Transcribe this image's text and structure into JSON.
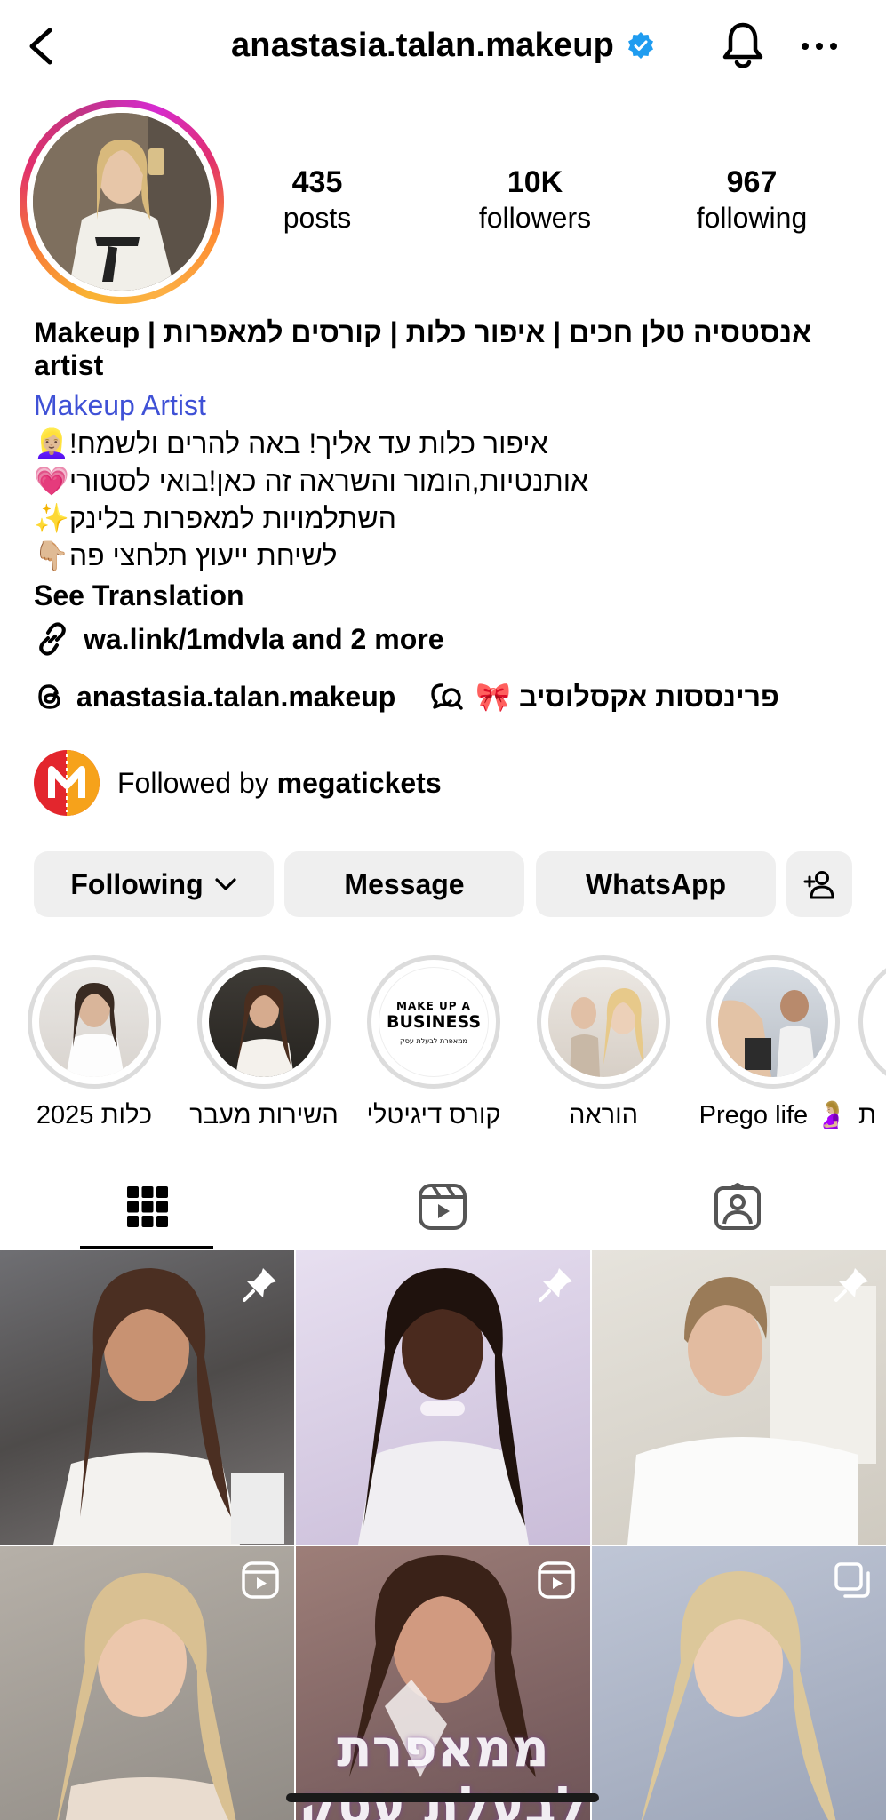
{
  "header": {
    "username": "anastasia.talan.makeup",
    "verified_icon": "verified-badge-icon",
    "accent": "#1f9cf0"
  },
  "stats": {
    "posts": {
      "value": "435",
      "label": "posts"
    },
    "followers": {
      "value": "10K",
      "label": "followers"
    },
    "following": {
      "value": "967",
      "label": "following"
    }
  },
  "bio": {
    "name_line1": "אנסטסיה טלן חכים | איפור כלות | קורסים למאפרות | Makeup",
    "name_line2": "artist",
    "category": "Makeup Artist",
    "lines": [
      "איפור כלות עד אליך! באה להרים ולשמח!👱🏼‍♀️",
      "אותנטיות,הומור והשראה זה כאן!בואי לסטורי💗",
      "השתלמויות למאפרות בלינק✨",
      "לשיחת ייעוץ תלחצי פה👇🏼"
    ],
    "see_translation": "See Translation",
    "link": "wa.link/1mdvla and 2 more",
    "threads_handle": "anastasia.talan.makeup",
    "community": "פרינססות אקסלוסיב 🎀"
  },
  "followed_by": {
    "prefix": "Followed by",
    "user": "megatickets"
  },
  "buttons": {
    "following": "Following",
    "message": "Message",
    "whatsapp": "WhatsApp"
  },
  "highlights": [
    {
      "label": "כלות 2025"
    },
    {
      "label": "השירות מעבר"
    },
    {
      "label": "קורס דיגיטלי"
    },
    {
      "label": "הוראה"
    },
    {
      "label": "Prego life 🤰🏼"
    },
    {
      "label": "ת"
    }
  ],
  "highlight_business": {
    "line1": "MAKE UP A",
    "line2": "BUSINESS",
    "line3": "ממאפרת לבעלת עסק"
  },
  "tabs": [
    "grid-icon",
    "reels-icon",
    "tagged-icon"
  ],
  "grid_overlay": {
    "line1": "ממאפרת",
    "line2": "לבעלת עסק"
  }
}
